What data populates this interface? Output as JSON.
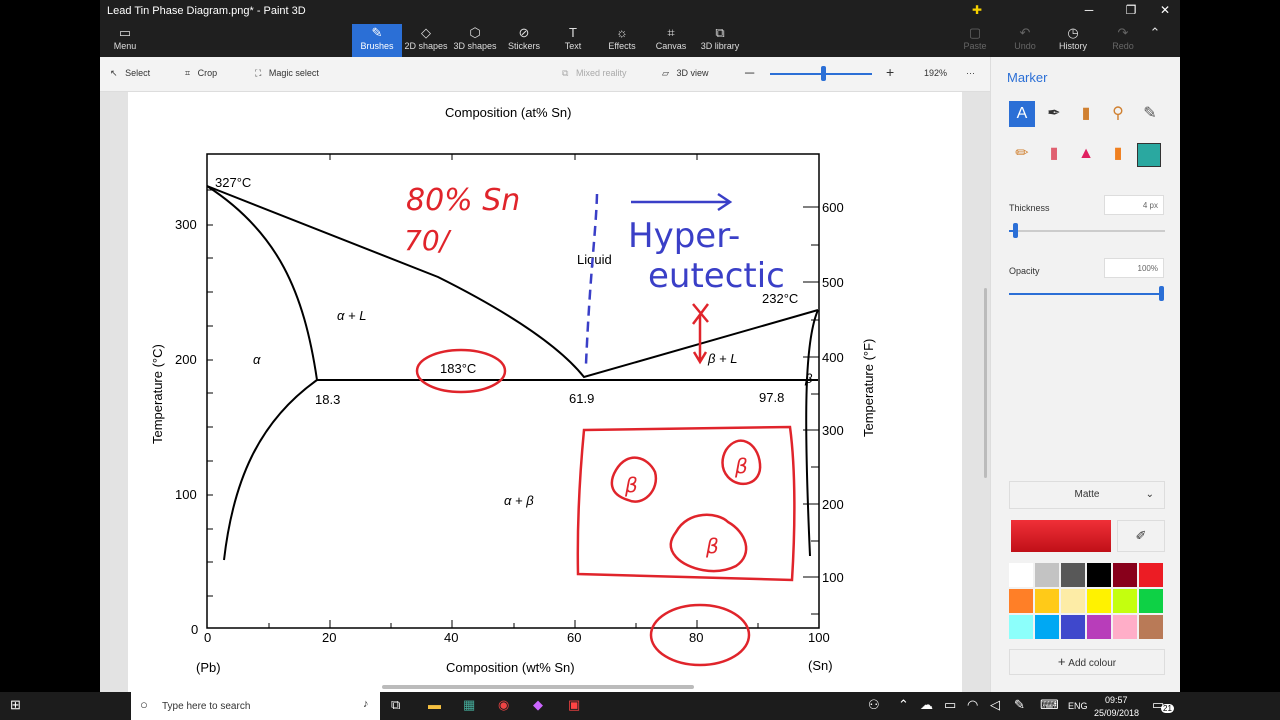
{
  "app": {
    "title": "Lead Tin Phase Diagram.png* - Paint 3D"
  },
  "ribbon": {
    "menu_label": "Menu",
    "tools": [
      {
        "label": "Brushes",
        "icon": "brush-icon"
      },
      {
        "label": "2D shapes",
        "icon": "2d-shapes-icon"
      },
      {
        "label": "3D shapes",
        "icon": "3d-shapes-icon"
      },
      {
        "label": "Stickers",
        "icon": "stickers-icon"
      },
      {
        "label": "Text",
        "icon": "text-icon"
      },
      {
        "label": "Effects",
        "icon": "effects-icon"
      },
      {
        "label": "Canvas",
        "icon": "canvas-icon"
      },
      {
        "label": "3D library",
        "icon": "3d-library-icon"
      }
    ],
    "paste": "Paste",
    "undo": "Undo",
    "history": "History",
    "redo": "Redo"
  },
  "toolbar": {
    "select": "Select",
    "crop": "Crop",
    "magic_select": "Magic select",
    "mixed_reality": "Mixed reality",
    "view_3d": "3D view",
    "zoom": "192%",
    "more": "···"
  },
  "diagram": {
    "top_axis": "Composition (at% Sn)",
    "bottom_axis": "Composition (wt% Sn)",
    "left_axis": "Temperature (°C)",
    "right_axis": "Temperature (°F)",
    "left_ticks": [
      "300",
      "200",
      "100",
      "0"
    ],
    "right_ticks": [
      "600",
      "500",
      "400",
      "300",
      "200",
      "100"
    ],
    "bottom_ticks": [
      "0",
      "20",
      "40",
      "60",
      "80",
      "100"
    ],
    "pb": "(Pb)",
    "sn": "(Sn)",
    "t327": "327°C",
    "t232": "232°C",
    "t183": "183°C",
    "c183": "18.3",
    "c619": "61.9",
    "c978": "97.8",
    "liquid": "Liquid",
    "alpha": "α",
    "alpha_l": "α + L",
    "beta_l": "β + L",
    "beta": "β",
    "alpha_beta": "α + β"
  },
  "annotations": {
    "red_note1": "80% Sn",
    "red_note2": "70/",
    "blue_note1": "Hyper-",
    "blue_note2": "eutectic",
    "beta_mark": "β"
  },
  "side": {
    "title": "Marker",
    "thickness_label": "Thickness",
    "thickness_value": "4 px",
    "opacity_label": "Opacity",
    "opacity_value": "100%",
    "finish": "Matte",
    "add_colour": "Add colour",
    "colors": [
      "#ffffff",
      "#c3c3c3",
      "#585858",
      "#000000",
      "#88001b",
      "#ec1c24",
      "#ff7f27",
      "#ffca18",
      "#fdeca6",
      "#fff200",
      "#c4ff0e",
      "#0ed145",
      "#8cfffb",
      "#00a8f3",
      "#3f48cc",
      "#b83dba",
      "#ffaec8",
      "#b97a57"
    ],
    "current_color": "#e0242b"
  },
  "taskbar": {
    "search": "Type here to search",
    "lang": "ENG",
    "time": "09:57",
    "date": "25/09/2018",
    "notif": "21"
  }
}
